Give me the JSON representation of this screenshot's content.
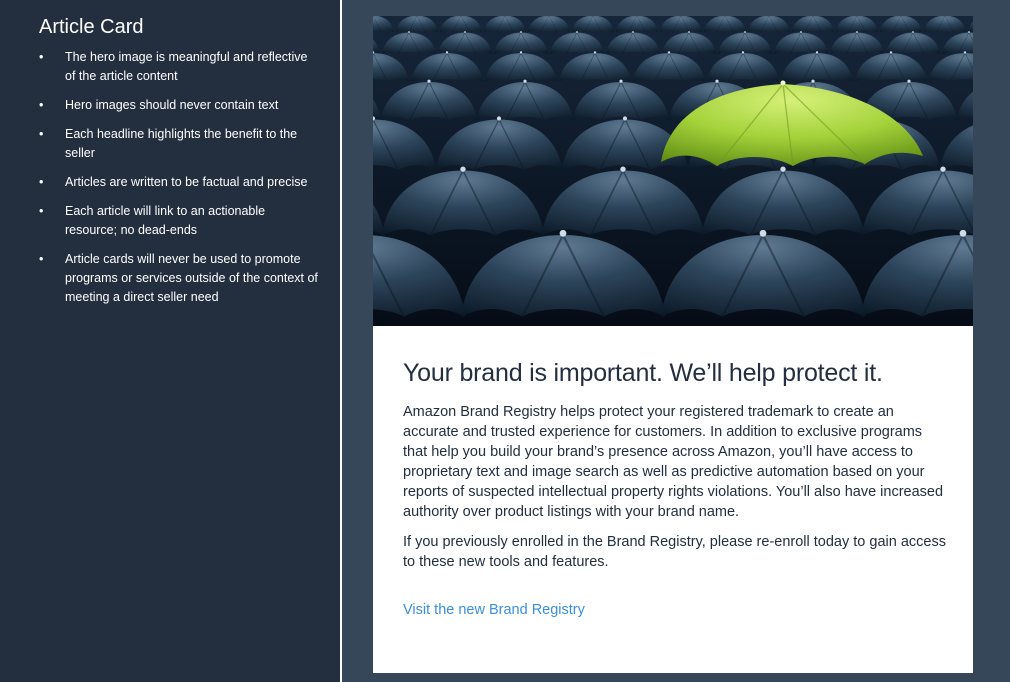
{
  "sidebar": {
    "title": "Article Card",
    "bullet": "•",
    "items": [
      "The hero image is meaningful and reflective of the article content",
      "Hero images should never contain text",
      "Each headline highlights the benefit to the seller",
      "Articles are written to be factual and precise",
      "Each article will link to an actionable resource; no dead-ends",
      "Article cards will never be used to promote programs or services outside of the context of meeting a direct seller need"
    ]
  },
  "card": {
    "hero_icon": "umbrellas-photo",
    "headline": "Your brand is important. We’ll help protect it.",
    "paragraphs": [
      "Amazon Brand Registry helps protect your registered trademark to create an accurate and trusted experience for customers. In addition to exclusive programs that help you build your brand’s presence across Amazon, you’ll have access to proprietary text and image search as well as predictive automation based on your reports of suspected intellectual property rights violations. You’ll also have increased authority over product listings with your brand name.",
      "If you previously enrolled in the Brand Registry, please re-enroll today to gain access to these new tools and features."
    ],
    "link_label": "Visit the new Brand Registry"
  },
  "colors": {
    "sidebar_bg": "#232f3e",
    "panel_bg": "#37475a",
    "link": "#3b8fd9",
    "accent_umbrella": "#a4d23a"
  }
}
